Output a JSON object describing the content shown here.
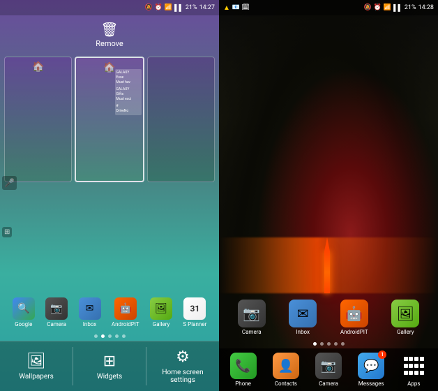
{
  "left": {
    "status": {
      "time": "14:27",
      "battery": "21%"
    },
    "remove_label": "Remove",
    "screens": [
      {
        "id": "screen1",
        "active": false
      },
      {
        "id": "screen2",
        "active": true
      },
      {
        "id": "screen3",
        "active": false
      }
    ],
    "apps": [
      {
        "name": "Google",
        "label": "Google",
        "icon": "🔍",
        "type": "google"
      },
      {
        "name": "Camera",
        "label": "Camera",
        "icon": "📷",
        "type": "camera"
      },
      {
        "name": "Inbox",
        "label": "Inbox",
        "icon": "✉",
        "type": "inbox"
      },
      {
        "name": "AndroidPIT",
        "label": "AndroidPIT",
        "icon": "🤖",
        "type": "androidpit"
      },
      {
        "name": "Gallery",
        "label": "Gallery",
        "icon": "🖼",
        "type": "gallery"
      },
      {
        "name": "S Planner",
        "label": "S Planner",
        "icon": "📅",
        "type": "calendar"
      }
    ],
    "page_dots": [
      1,
      2,
      3,
      4,
      5
    ],
    "active_dot": 1,
    "toolbar": [
      {
        "id": "wallpapers",
        "label": "Wallpapers",
        "icon": "🖼"
      },
      {
        "id": "widgets",
        "label": "Widgets",
        "icon": "⊞"
      },
      {
        "id": "home-screen-settings",
        "label": "Home screen settings",
        "icon": "⚙"
      }
    ]
  },
  "right": {
    "status": {
      "time": "14:28",
      "battery": "21%",
      "alert": "▲"
    },
    "apps_row1": [
      {
        "name": "Camera",
        "label": "Camera",
        "icon": "📷",
        "type": "camera"
      },
      {
        "name": "Inbox",
        "label": "Inbox",
        "icon": "✉",
        "type": "inbox"
      },
      {
        "name": "AndroidPIT",
        "label": "AndroidPIT",
        "icon": "🤖",
        "type": "androidpit"
      },
      {
        "name": "Gallery",
        "label": "Gallery",
        "icon": "🖼",
        "type": "gallery"
      }
    ],
    "page_dots": [
      1,
      2,
      3,
      4,
      5
    ],
    "active_dot": 0,
    "dock": [
      {
        "name": "Phone",
        "label": "Phone",
        "icon": "📞",
        "type": "phone"
      },
      {
        "name": "Contacts",
        "label": "Contacts",
        "icon": "👤",
        "type": "contacts"
      },
      {
        "name": "Camera",
        "label": "Camera",
        "icon": "📷",
        "type": "camera"
      },
      {
        "name": "Messages",
        "label": "Messages",
        "icon": "💬",
        "type": "messages",
        "badge": "1"
      },
      {
        "name": "Apps",
        "label": "Apps",
        "icon": "⊞",
        "type": "apps"
      }
    ]
  }
}
